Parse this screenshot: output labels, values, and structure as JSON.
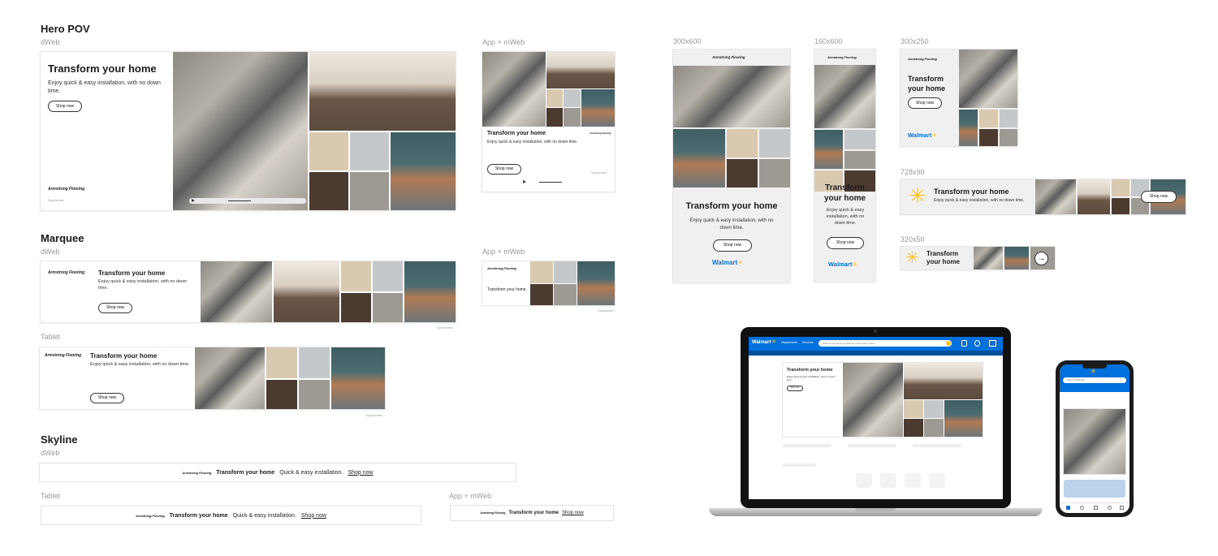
{
  "sections": {
    "hero": "Hero POV",
    "marquee": "Marquee",
    "skyline": "Skyline"
  },
  "labels": {
    "dweb": "dWeb",
    "app_mweb": "App + mWeb",
    "tablet": "Tablet",
    "s300x600": "300x600",
    "s160x600": "160x600",
    "s300x250": "300x250",
    "s728x90": "728x90",
    "s320x50": "320x50"
  },
  "ad": {
    "headline": "Transform your home",
    "headline_line1": "Transform",
    "headline_line2": "your home",
    "body": "Enjoy quick & easy installation, with no down time.",
    "body_short": "Enjoy quick & easy installation,",
    "body_160": "Enjoy quick & easy installation, with no down time.",
    "cta": "Shop now",
    "sponsored": "Sponsored",
    "brand": "Armstrong Flooring",
    "walmart": "Walmart",
    "skyline_copy": "Quick & easy installation."
  },
  "laptop_ui": {
    "logo": "Walmart",
    "departments": "Departments",
    "services": "Services",
    "search_placeholder": "Search everything at Walmart online and in store",
    "headline": "Transform your home",
    "body": "Enjoy quick & easy installation, with no down time.",
    "cta": "Shop now"
  },
  "phone_ui": {
    "search_placeholder": "Search Walmart"
  },
  "colors": {
    "walmart_blue": "#0071dc",
    "walmart_yellow": "#ffc220"
  }
}
